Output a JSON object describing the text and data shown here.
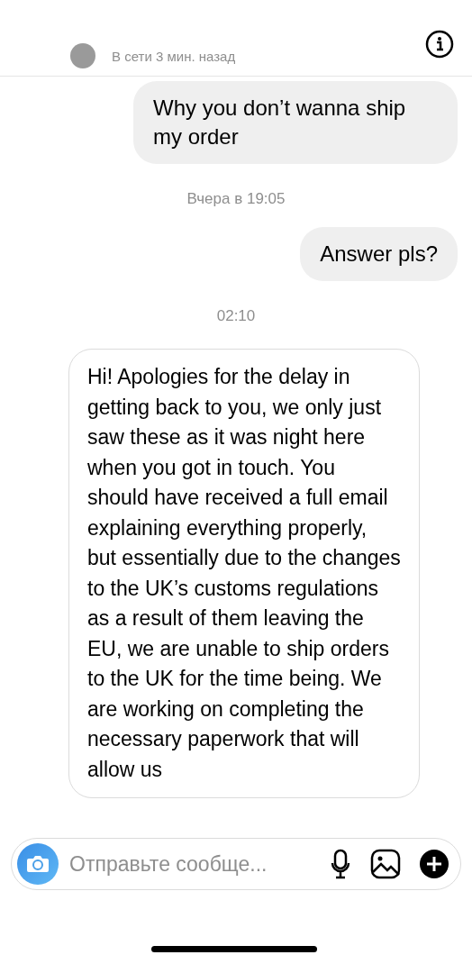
{
  "header": {
    "status": "В сети 3 мин. назад"
  },
  "messages": [
    {
      "kind": "outgoing",
      "text": "Why you don’t wanna ship my order"
    },
    {
      "kind": "time",
      "text": "Вчера в 19:05"
    },
    {
      "kind": "outgoing",
      "text": "Answer pls?"
    },
    {
      "kind": "time",
      "text": "02:10"
    },
    {
      "kind": "incoming",
      "text": "Hi! Apologies for the delay in getting back to you, we only just saw these as it was night here when you got in touch. You should have received a full email explaining everything properly, but essentially due to the changes to the UK’s customs regulations as a result of them leaving the EU, we are unable to ship orders to the UK for the time being. We are working on completing the necessary paperwork that will allow us"
    }
  ],
  "composer": {
    "placeholder": "Отправьте сообще..."
  }
}
